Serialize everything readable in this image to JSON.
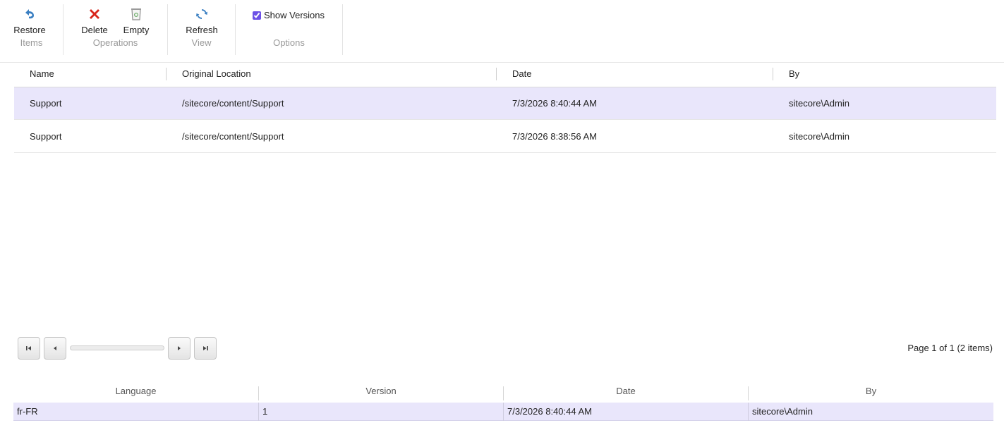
{
  "ribbon": {
    "groups": [
      {
        "caption": "Items",
        "buttons": [
          {
            "label": "Restore",
            "icon": "restore-icon"
          }
        ]
      },
      {
        "caption": "Operations",
        "buttons": [
          {
            "label": "Delete",
            "icon": "delete-icon"
          },
          {
            "label": "Empty",
            "icon": "recycle-bin-icon"
          }
        ]
      },
      {
        "caption": "View",
        "buttons": [
          {
            "label": "Refresh",
            "icon": "refresh-icon"
          }
        ]
      },
      {
        "caption": "Options",
        "checkbox": {
          "label": "Show Versions",
          "checked": true
        }
      }
    ]
  },
  "grid": {
    "columns": [
      "Name",
      "Original Location",
      "Date",
      "By"
    ],
    "rows": [
      {
        "name": "Support",
        "location": "/sitecore/content/Support",
        "date": "7/3/2026 8:40:44 AM",
        "by": "sitecore\\Admin",
        "selected": true
      },
      {
        "name": "Support",
        "location": "/sitecore/content/Support",
        "date": "7/3/2026 8:38:56 AM",
        "by": "sitecore\\Admin",
        "selected": false
      }
    ]
  },
  "pager": {
    "info": "Page 1 of 1 (2 items)",
    "buttons": [
      "first-page-icon",
      "previous-page-icon",
      "next-page-icon",
      "last-page-icon"
    ]
  },
  "versions": {
    "columns": [
      "Language",
      "Version",
      "Date",
      "By"
    ],
    "rows": [
      {
        "language": "fr-FR",
        "version": "1",
        "date": "7/3/2026 8:40:44 AM",
        "by": "sitecore\\Admin"
      }
    ]
  },
  "colors": {
    "selection": "#e9e6fb",
    "delete_red": "#d9261c",
    "icon_blue": "#3a7fc2"
  }
}
